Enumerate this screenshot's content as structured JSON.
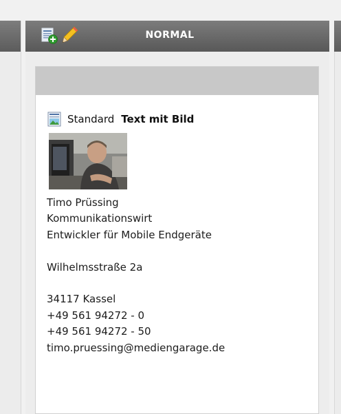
{
  "column": {
    "title": "NORMAL",
    "new_icon": "new-content-icon",
    "edit_icon": "pencil-icon"
  },
  "content_element": {
    "icon": "text-with-image-icon",
    "type_label": "Standard",
    "header": "Text mit Bild",
    "image": "portrait-photo",
    "lines": {
      "name": "Timo Prüssing",
      "title": "Kommunikationswirt",
      "role": "Entwickler für Mobile Endgeräte",
      "street": "Wilhelmsstraße 2a",
      "city": "34117 Kassel",
      "phone": "+49 561 94272 - 0",
      "fax": "+49 561 94272 - 50",
      "email": "timo.pruessing@mediengarage.de"
    }
  },
  "colors": {
    "header_bar": "#666666",
    "drop_bar": "#c8c8c8",
    "page_background": "#f1f1f1"
  }
}
